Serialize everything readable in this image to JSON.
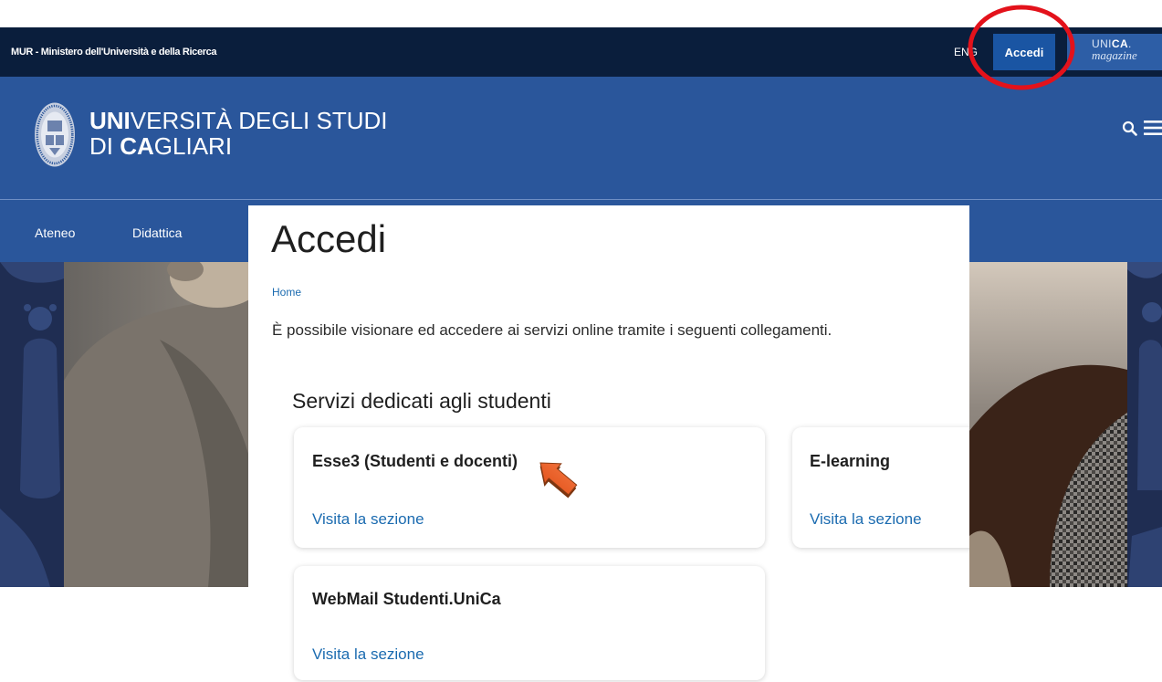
{
  "topbar": {
    "ministry": "MUR - Ministero dell'Università e della Ricerca",
    "lang": "ENG",
    "login": "Accedi",
    "magazine": {
      "brand_light": "UNI",
      "brand_bold": "CA",
      "dot": ".",
      "sub": "magazine"
    }
  },
  "header": {
    "line1_bold": "UNI",
    "line1_rest": "VERSITÀ DEGLI STUDI",
    "line2_prefix": "DI ",
    "line2_bold": "CA",
    "line2_rest": "GLIARI"
  },
  "nav": {
    "items": [
      "Ateneo",
      "Didattica"
    ]
  },
  "page": {
    "title": "Accedi",
    "breadcrumb": "Home",
    "intro": "È possibile visionare ed accedere ai servizi online tramite i seguenti collegamenti.",
    "section_title": "Servizi dedicati agli studenti",
    "cards": [
      {
        "title": "Esse3 (Studenti e docenti)",
        "link": "Visita la sezione"
      },
      {
        "title": "E-learning",
        "link": "Visita la sezione"
      },
      {
        "title": "WebMail Studenti.UniCa",
        "link": "Visita la sezione"
      }
    ]
  },
  "icons": {
    "logo": "university-seal-icon",
    "search": "search-icon",
    "menu": "hamburger-menu-icon",
    "annotation_circle": "red-circle-annotation",
    "annotation_arrow": "orange-arrow-annotation"
  },
  "colors": {
    "topbar_bg": "#0a1e3c",
    "header_bg": "#2a569b",
    "link": "#1b6bb0",
    "login_bg": "#1a55a3",
    "magazine_bg": "#2d5ea6",
    "annotation_circle": "#e3121b",
    "annotation_arrow": "#e4561f"
  }
}
